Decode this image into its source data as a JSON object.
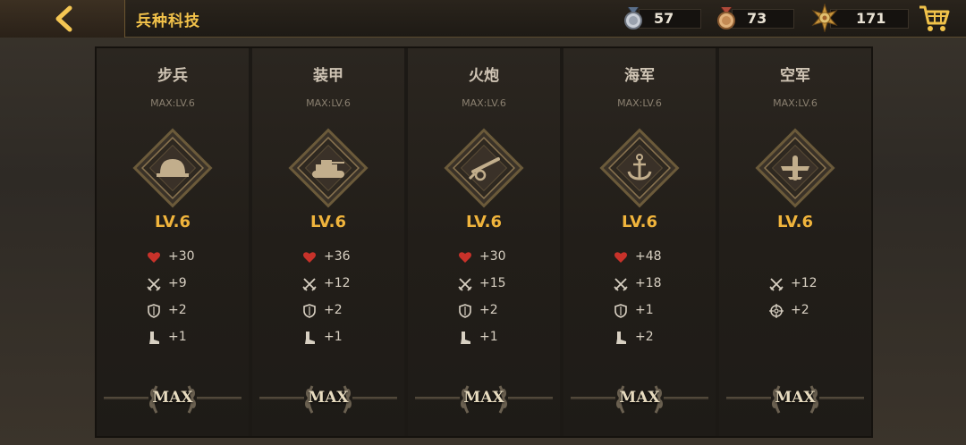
{
  "header": {
    "title": "兵种科技",
    "back_icon": "chevron-left-icon",
    "resources": [
      {
        "icon": "silver-medal-icon",
        "value": "57"
      },
      {
        "icon": "bronze-medal-icon",
        "value": "73"
      },
      {
        "icon": "sun-badge-icon",
        "value": "171"
      }
    ],
    "cart_icon": "shopping-cart-icon"
  },
  "branches": [
    {
      "name": "步兵",
      "max": "MAX:LV.6",
      "emblem": "helmet-icon",
      "level": "LV.6",
      "stats": [
        {
          "icon": "heart-icon",
          "value": "+30"
        },
        {
          "icon": "crossed-swords-icon",
          "value": "+9"
        },
        {
          "icon": "shield-icon",
          "value": "+2"
        },
        {
          "icon": "boot-icon",
          "value": "+1"
        }
      ],
      "badge": "MAX"
    },
    {
      "name": "装甲",
      "max": "MAX:LV.6",
      "emblem": "tank-icon",
      "level": "LV.6",
      "stats": [
        {
          "icon": "heart-icon",
          "value": "+36"
        },
        {
          "icon": "crossed-swords-icon",
          "value": "+12"
        },
        {
          "icon": "shield-icon",
          "value": "+2"
        },
        {
          "icon": "boot-icon",
          "value": "+1"
        }
      ],
      "badge": "MAX"
    },
    {
      "name": "火炮",
      "max": "MAX:LV.6",
      "emblem": "artillery-icon",
      "level": "LV.6",
      "stats": [
        {
          "icon": "heart-icon",
          "value": "+30"
        },
        {
          "icon": "crossed-swords-icon",
          "value": "+15"
        },
        {
          "icon": "shield-icon",
          "value": "+2"
        },
        {
          "icon": "boot-icon",
          "value": "+1"
        }
      ],
      "badge": "MAX"
    },
    {
      "name": "海军",
      "max": "MAX:LV.6",
      "emblem": "anchor-icon",
      "level": "LV.6",
      "stats": [
        {
          "icon": "heart-icon",
          "value": "+48"
        },
        {
          "icon": "crossed-swords-icon",
          "value": "+18"
        },
        {
          "icon": "shield-icon",
          "value": "+1"
        },
        {
          "icon": "boot-icon",
          "value": "+2"
        }
      ],
      "badge": "MAX"
    },
    {
      "name": "空军",
      "max": "MAX:LV.6",
      "emblem": "airplane-icon",
      "level": "LV.6",
      "stats": [
        {
          "icon": "crossed-swords-icon",
          "value": "+12"
        },
        {
          "icon": "crosshair-icon",
          "value": "+2"
        }
      ],
      "badge": "MAX"
    }
  ],
  "colors": {
    "title": "#f2c24a",
    "level": "#f0b43c",
    "heart": "#c8322a",
    "panel": "#221e19"
  }
}
